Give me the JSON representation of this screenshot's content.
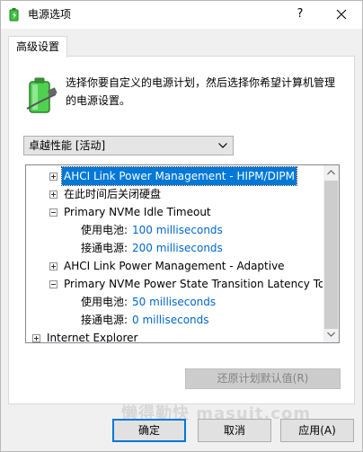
{
  "window": {
    "title": "电源选项",
    "help_label": "?",
    "close_icon": "close-icon",
    "app_icon": "power-options-icon"
  },
  "tabs": [
    {
      "label": "高级设置",
      "selected": true
    }
  ],
  "description": "选择你要自定义的电源计划，然后选择你希望计算机管理的电源设置。",
  "description_lines": [
    "选择你要自定义的电源计划，然后选择你希望计算机管理",
    "的电源设置。"
  ],
  "plan_dropdown": {
    "selected": "卓越性能 [活动]"
  },
  "tree": {
    "rows": [
      {
        "text": "AHCI Link Power Management - HIPM/DIPM",
        "expander": "plus",
        "selected": true
      },
      {
        "text": "在此时间后关闭硬盘",
        "expander": "plus"
      },
      {
        "text": "Primary NVMe Idle Timeout",
        "expander": "minus"
      },
      {
        "label": "使用电池:",
        "value": "100 milliseconds"
      },
      {
        "label": "接通电源:",
        "value": "200 milliseconds"
      },
      {
        "text": "AHCI Link Power Management - Adaptive",
        "expander": "plus"
      },
      {
        "text": "Primary NVMe Power State Transition Latency Tol",
        "expander": "minus"
      },
      {
        "label": "使用电池:",
        "value": "50 milliseconds"
      },
      {
        "label": "接通电源:",
        "value": "0 milliseconds"
      },
      {
        "text": "Internet Explorer",
        "expander": "plus"
      }
    ]
  },
  "restore_button": "还原计划默认值(R)",
  "buttons": {
    "ok": "确定",
    "cancel": "取消",
    "apply": "应用(A)"
  },
  "watermark": "懒得勤快 masuit.com",
  "colors": {
    "selection": "#0078d7",
    "value_text": "#0066cc",
    "battery_green": "#3cc43c"
  }
}
